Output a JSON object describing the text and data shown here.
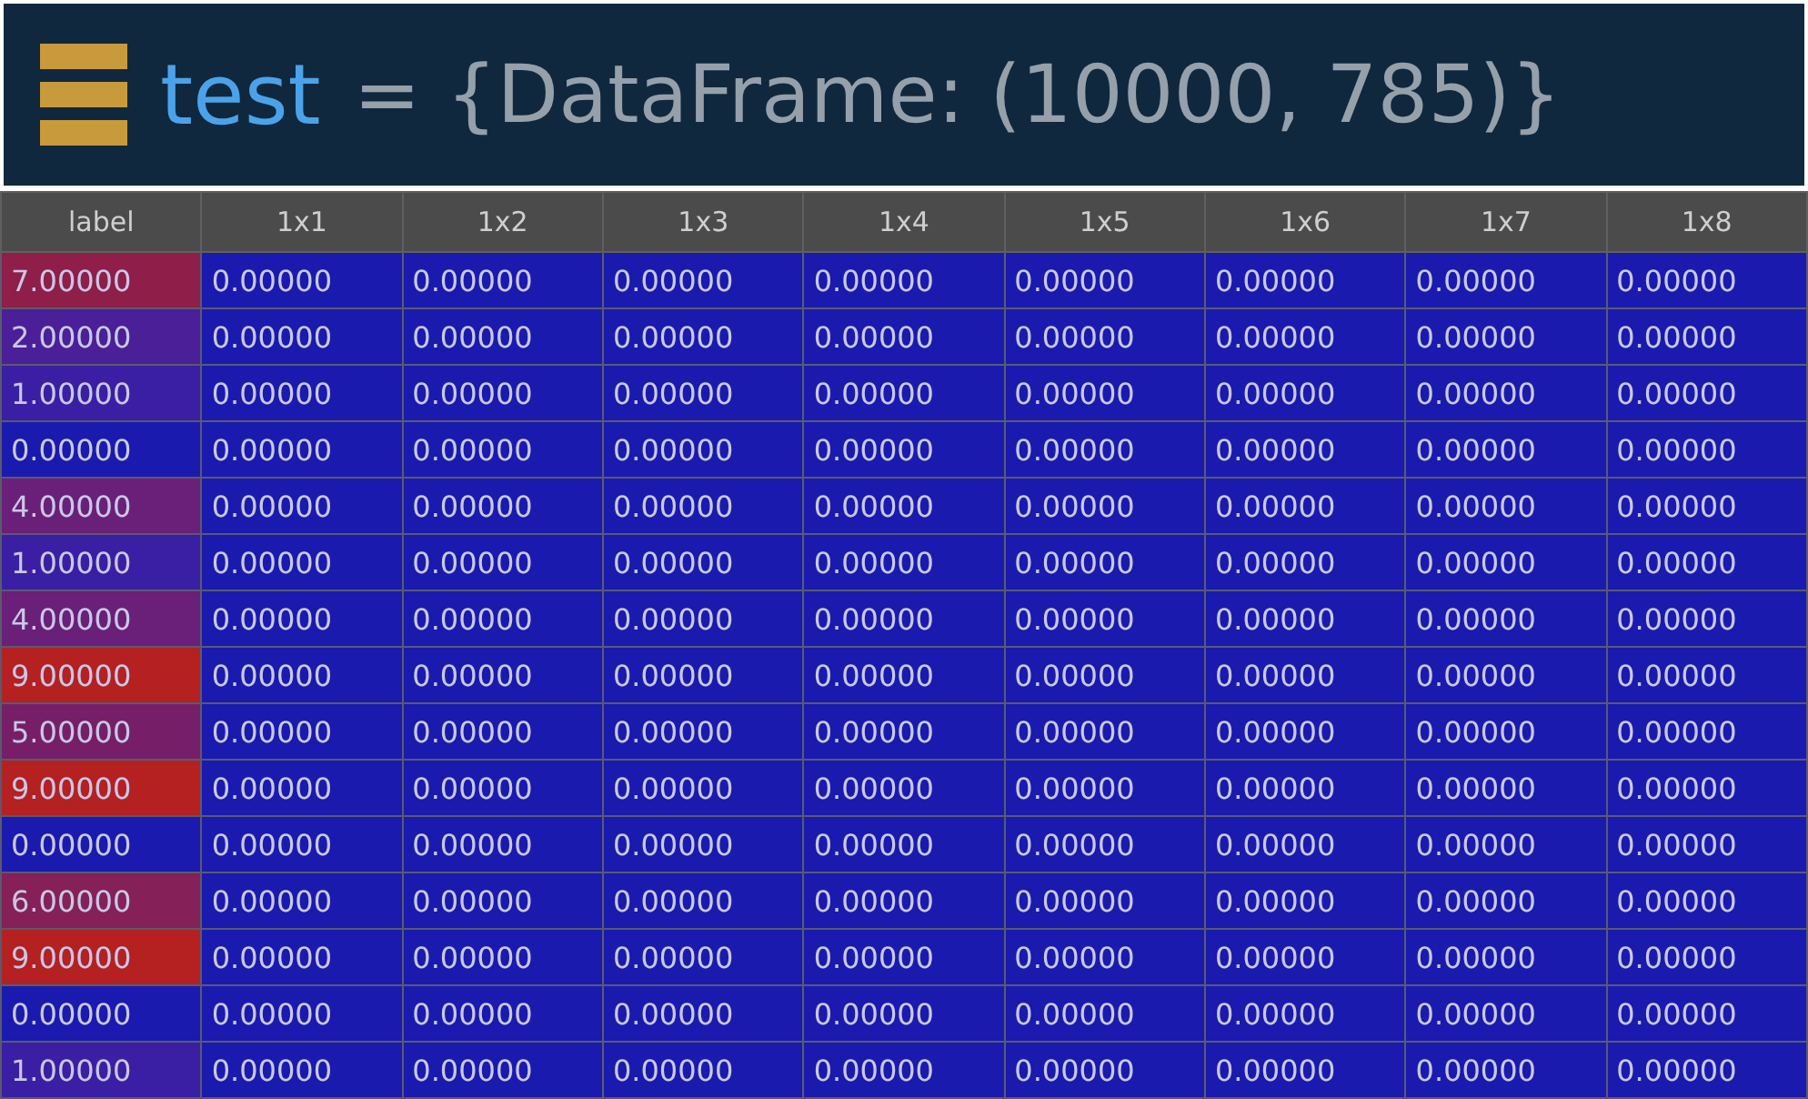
{
  "header": {
    "variable": "test",
    "value": "= {DataFrame: (10000, 785)}"
  },
  "table": {
    "columns": [
      "label",
      "1x1",
      "1x2",
      "1x3",
      "1x4",
      "1x5",
      "1x6",
      "1x7",
      "1x8"
    ],
    "rows": [
      {
        "color": "#8f1e48",
        "cells": [
          "7.00000",
          "0.00000",
          "0.00000",
          "0.00000",
          "0.00000",
          "0.00000",
          "0.00000",
          "0.00000",
          "0.00000"
        ]
      },
      {
        "color": "#4a1f98",
        "cells": [
          "2.00000",
          "0.00000",
          "0.00000",
          "0.00000",
          "0.00000",
          "0.00000",
          "0.00000",
          "0.00000",
          "0.00000"
        ]
      },
      {
        "color": "#3a1fa5",
        "cells": [
          "1.00000",
          "0.00000",
          "0.00000",
          "0.00000",
          "0.00000",
          "0.00000",
          "0.00000",
          "0.00000",
          "0.00000"
        ]
      },
      {
        "color": "#1a1aae",
        "cells": [
          "0.00000",
          "0.00000",
          "0.00000",
          "0.00000",
          "0.00000",
          "0.00000",
          "0.00000",
          "0.00000",
          "0.00000"
        ]
      },
      {
        "color": "#6a1f78",
        "cells": [
          "4.00000",
          "0.00000",
          "0.00000",
          "0.00000",
          "0.00000",
          "0.00000",
          "0.00000",
          "0.00000",
          "0.00000"
        ]
      },
      {
        "color": "#3a1fa5",
        "cells": [
          "1.00000",
          "0.00000",
          "0.00000",
          "0.00000",
          "0.00000",
          "0.00000",
          "0.00000",
          "0.00000",
          "0.00000"
        ]
      },
      {
        "color": "#6a1f78",
        "cells": [
          "4.00000",
          "0.00000",
          "0.00000",
          "0.00000",
          "0.00000",
          "0.00000",
          "0.00000",
          "0.00000",
          "0.00000"
        ]
      },
      {
        "color": "#b52020",
        "cells": [
          "9.00000",
          "0.00000",
          "0.00000",
          "0.00000",
          "0.00000",
          "0.00000",
          "0.00000",
          "0.00000",
          "0.00000"
        ]
      },
      {
        "color": "#761f68",
        "cells": [
          "5.00000",
          "0.00000",
          "0.00000",
          "0.00000",
          "0.00000",
          "0.00000",
          "0.00000",
          "0.00000",
          "0.00000"
        ]
      },
      {
        "color": "#b52020",
        "cells": [
          "9.00000",
          "0.00000",
          "0.00000",
          "0.00000",
          "0.00000",
          "0.00000",
          "0.00000",
          "0.00000",
          "0.00000"
        ]
      },
      {
        "color": "#1a1aae",
        "cells": [
          "0.00000",
          "0.00000",
          "0.00000",
          "0.00000",
          "0.00000",
          "0.00000",
          "0.00000",
          "0.00000",
          "0.00000"
        ]
      },
      {
        "color": "#852059",
        "cells": [
          "6.00000",
          "0.00000",
          "0.00000",
          "0.00000",
          "0.00000",
          "0.00000",
          "0.00000",
          "0.00000",
          "0.00000"
        ]
      },
      {
        "color": "#b52020",
        "cells": [
          "9.00000",
          "0.00000",
          "0.00000",
          "0.00000",
          "0.00000",
          "0.00000",
          "0.00000",
          "0.00000",
          "0.00000"
        ]
      },
      {
        "color": "#1a1aae",
        "cells": [
          "0.00000",
          "0.00000",
          "0.00000",
          "0.00000",
          "0.00000",
          "0.00000",
          "0.00000",
          "0.00000",
          "0.00000"
        ]
      },
      {
        "color": "#3a1fa5",
        "cells": [
          "1.00000",
          "0.00000",
          "0.00000",
          "0.00000",
          "0.00000",
          "0.00000",
          "0.00000",
          "0.00000",
          "0.00000"
        ]
      }
    ]
  }
}
